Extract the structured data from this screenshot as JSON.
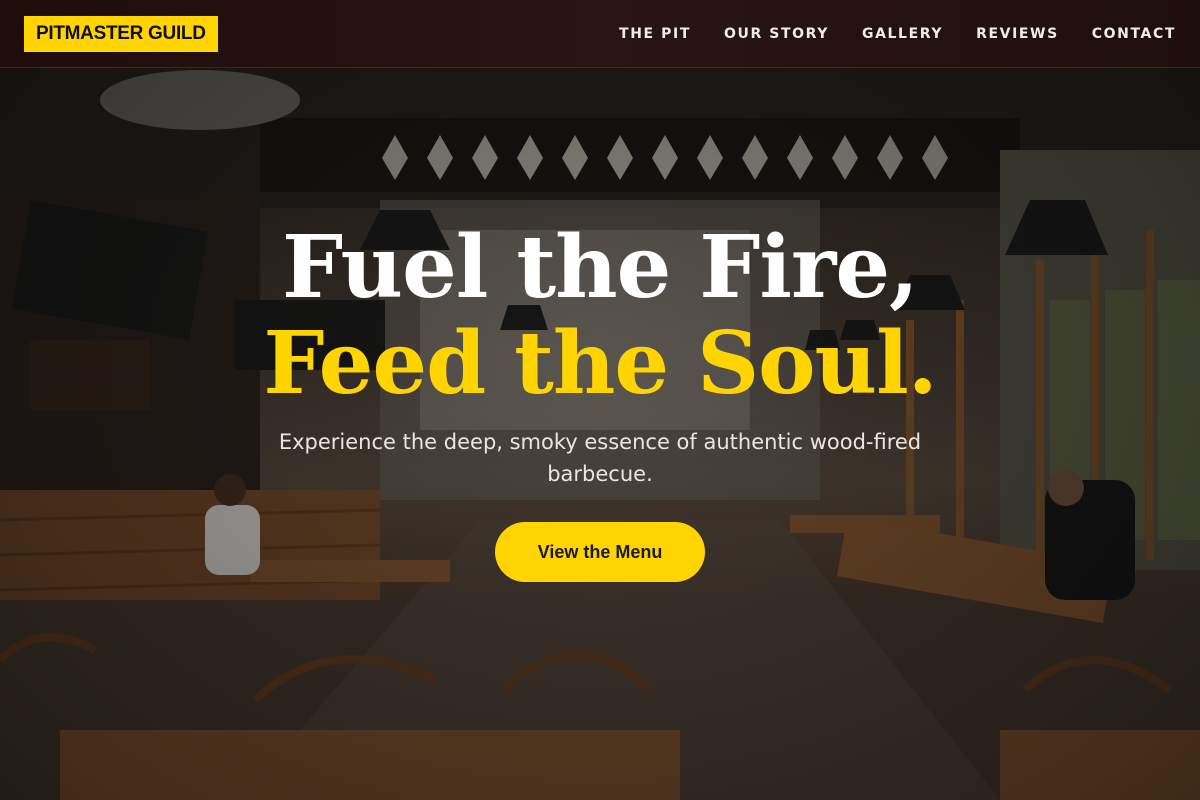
{
  "nav": {
    "logo": "PITMASTER GUILD",
    "links": [
      {
        "label": "THE PIT"
      },
      {
        "label": "OUR STORY"
      },
      {
        "label": "GALLERY"
      },
      {
        "label": "REVIEWS"
      },
      {
        "label": "CONTACT"
      }
    ]
  },
  "hero": {
    "headline_line1": "Fuel the Fire,",
    "headline_line2": "Feed the Soul.",
    "subtext": "Experience the deep, smoky essence of authentic wood-fired barbecue.",
    "cta_label": "View the Menu"
  },
  "colors": {
    "accent": "#ffd400",
    "nav_background": "#2a1512",
    "headline_white": "#ffffff",
    "text_dark": "#1a1a1a"
  }
}
